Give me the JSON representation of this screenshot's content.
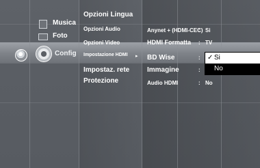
{
  "sidebar": {
    "items": [
      {
        "label": "Musica",
        "icon": "music-icon"
      },
      {
        "label": "Foto",
        "icon": "photo-icon"
      },
      {
        "label": "Config",
        "icon": "gear-icon"
      }
    ]
  },
  "submenu": {
    "items": [
      {
        "label": "Opzioni Lingua"
      },
      {
        "label": "Opzioni Audio"
      },
      {
        "label": "Opzioni Video"
      },
      {
        "label": "Impostazione HDMI"
      },
      {
        "label": "Impostaz. rete"
      },
      {
        "label": "Protezione"
      }
    ],
    "active_arrow": "▸"
  },
  "settings": {
    "rows": [
      {
        "label": "Anynet + (HDMI-CEC)",
        "sep": ":",
        "value": "Si"
      },
      {
        "label": "HDMI Formatta",
        "sep": ":",
        "value": "TV"
      },
      {
        "label": "BD Wise",
        "sep": ":",
        "value": ""
      },
      {
        "label": "Immagine",
        "sep": ":",
        "value": ""
      },
      {
        "label": "Audio HDMI",
        "sep": ":",
        "value": "No"
      }
    ]
  },
  "dropdown": {
    "selected": "Si",
    "check_mark": "✓",
    "other": "No"
  },
  "colors": {
    "background": "#5a5e64",
    "highlight": "#8d9197",
    "dropdown_bg": "#ffffff",
    "dropdown_alt_bg": "#000000"
  }
}
